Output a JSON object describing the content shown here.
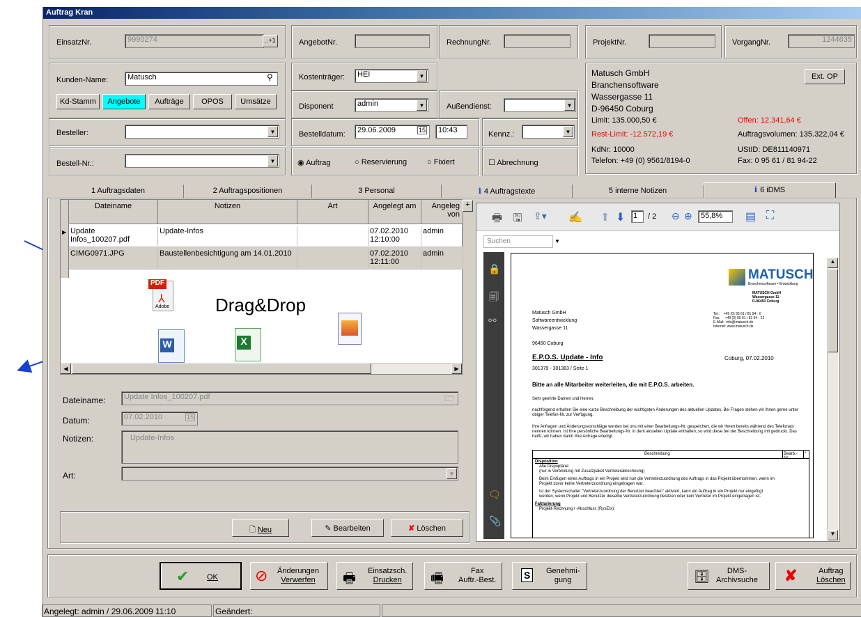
{
  "title": "Auftrag Kran",
  "f": {
    "einsatz_lbl": "EinsatzNr.",
    "einsatz_val": "9990274",
    "plus": "..+1",
    "angebot_lbl": "AngebotNr.",
    "rechnung_lbl": "RechnungNr.",
    "projekt_lbl": "ProjektNr.",
    "vorgang_lbl": "VorgangNr.",
    "vorgang_val": "1244635",
    "kunde_lbl": "Kunden-Name:",
    "kunde_val": "Matusch",
    "kosten_lbl": "Kostenträger:",
    "kosten_val": "HEI",
    "dispo_lbl": "Disponent",
    "dispo_val": "admin",
    "aussen_lbl": "Außendienst:",
    "besteller_lbl": "Besteller:",
    "bdatum_lbl": "Bestelldatum:",
    "bdatum_val": "29.06.2009",
    "bzeit_val": "10:43",
    "kennz_lbl": "Kennz.:",
    "bestellnr_lbl": "Bestell-Nr.:",
    "r_auftrag": "Auftrag",
    "r_reserv": "Reservierung",
    "r_fixiert": "Fixiert",
    "abrechnung": "Abrechnung"
  },
  "kbtn": [
    "Kd-Stamm",
    "Angebote",
    "Aufträge",
    "OPOS",
    "Umsätze"
  ],
  "cust": {
    "l1": "Matusch GmbH",
    "l2": "Branchensoftware",
    "l3": "Wassergasse 11",
    "l4": "D-96450   Coburg",
    "extop": "Ext. OP",
    "limit": "Limit: 135.000,50 €",
    "offen": "Offen: 12.341,64 €",
    "rest": "Rest-Limit: -12.572,19 €",
    "volumen": "Auftragsvolumen: 135.322,04 €",
    "kdnr": "KdNr:        10000",
    "ustid": "UStID:   DE811140971",
    "tel": "Telefon:   +49 (0) 9561/8194-0",
    "fax": "Fax:       0 95 61 / 81 94-22"
  },
  "tabs": [
    "1  Auftragsdaten",
    "2  Auftragspositionen",
    "3  Personal",
    "4  Auftragstexte",
    "5  interne Notizen",
    "6  iDMS"
  ],
  "grid": {
    "headers": [
      "Dateiname",
      "Notizen",
      "Art",
      "Angelegt am",
      "Angeleg von"
    ],
    "rows": [
      [
        "Update Infos_100207.pdf",
        "Update-Infos",
        "",
        "07.02.2010 12:10:00",
        "admin"
      ],
      [
        "CIMG0971.JPG",
        "Baustellenbesichtigung am 14.01.2010",
        "",
        "07.02.2010 12:11:00",
        "admin"
      ]
    ],
    "plus": "+"
  },
  "dragdrop": "Drag&Drop",
  "pdficon": "PDF",
  "adobe": "Adobe",
  "detail": {
    "name_lbl": "Dateiname:",
    "name_val": "Update Infos_100207.pdf",
    "datum_lbl": "Datum:",
    "datum_val": "07.02.2010",
    "notizen_lbl": "Notizen:",
    "notizen_val": "Update-Infos",
    "art_lbl": "Art:"
  },
  "actions": {
    "neu": "Neu",
    "bearbeiten": "Bearbeiten",
    "loeschen": "Löschen"
  },
  "pdf": {
    "page": "1",
    "of": "/ 2",
    "zoom": "55,8%",
    "search": "Suchen"
  },
  "doc": {
    "logo": "MATUSCH",
    "logo_sub": "Branchensoftware • Entwicklung",
    "sender": [
      "MATUSCH GmbH",
      "Wassergasse 11",
      "D-96450 Coburg"
    ],
    "addr1": "Matusch GmbH",
    "addr2": "Softwareentwicklung",
    "addr3": "Wassergasse 11",
    "addr4": "96450 Coburg",
    "contact": "Tel.:    +49 (0) 95 61 / 81 94 - 0\nFax:     +49 (0) 95 61 / 81 94 - 22\nE-Mail:  info@matusch.de\nInternet: www.matusch.de",
    "subject": "E.P.O.S. Update - Info",
    "date": "Coburg, 07.02.2010",
    "ref": "301379 - 301383 / Seite 1",
    "bold": "Bitte an alle Mitarbeiter weiterleiten, die mit E.P.O.S. arbeiten.",
    "p1": "Sehr geehrte Damen und Herren,",
    "p2": "nachfolgend erhalten Sie eine kurze Beschreibung der wichtigsten Änderungen des aktuellen Updates. Bei Fragen stehen wir Ihnen gerne unter obiger Telefon-Nr. zur Verfügung.",
    "p3": "Ihre Anfragen und Änderungsvorschläge werden bei uns mit einer Bearbeitungs-Nr. gespeichert, die wir Ihnen bereits während des Telefonats nennen können. Ist Ihre persönliche Bearbeitungs-Nr. in dem aktuellen Update enthalten, so wird diese bei der Beschreibung mit gedruckt. Das heißt, wir haben damit Ihre Anfrage erledigt.",
    "th1": "Beschreibung",
    "th2": "Bearb.-Nr.",
    "th3": "*",
    "s1": "Disposition",
    "s1a": "Alle Dispopläne:",
    "s1b": "(nur in Verbindung mit Zusatzpaket Vertreterabrechnung)",
    "s1c": "Beim Einfügen eines Auftrags in ein Projekt wird nun die Vertreterzuordnung des Auftrags in das Projekt übernommen, wenn im Projekt zuvor keine Vertreterzuordnung eingetragen war.",
    "s1d": "Ist der Systemschalter \"Vertreterzuordnung der Benutzer beachten\" aktiviert, kann ein Auftrag in ein Projekt nur eingefügt werden, wenn Projekt und Benutzer dieselbe Vertreterzuordnung besitzen oder kein Vertreter im Projekt eingetragen ist.",
    "s2": "Fakturierung",
    "s2a": "Projekt-Rechnung / -Abschluss (RysEIx):"
  },
  "bottom": {
    "ok": "OK",
    "aend1": "Änderungen",
    "aend2": "Verwerfen",
    "eins1": "Einsatzsch.",
    "eins2": "Drucken",
    "fax1": "Fax",
    "fax2": "Auftr.-Best.",
    "gen1": "Genehmi-",
    "gen2": "gung",
    "dms1": "DMS-",
    "dms2": "Archivsuche",
    "auf1": "Auftrag",
    "auf2": "Löschen"
  },
  "status": {
    "angelegt": "Angelegt: admin / 29.06.2009 11:10",
    "geaendert": "Geändert:"
  },
  "colors": {
    "arrow": "#1a3fd6",
    "accent": "#00ffff",
    "red": "#e00000"
  }
}
